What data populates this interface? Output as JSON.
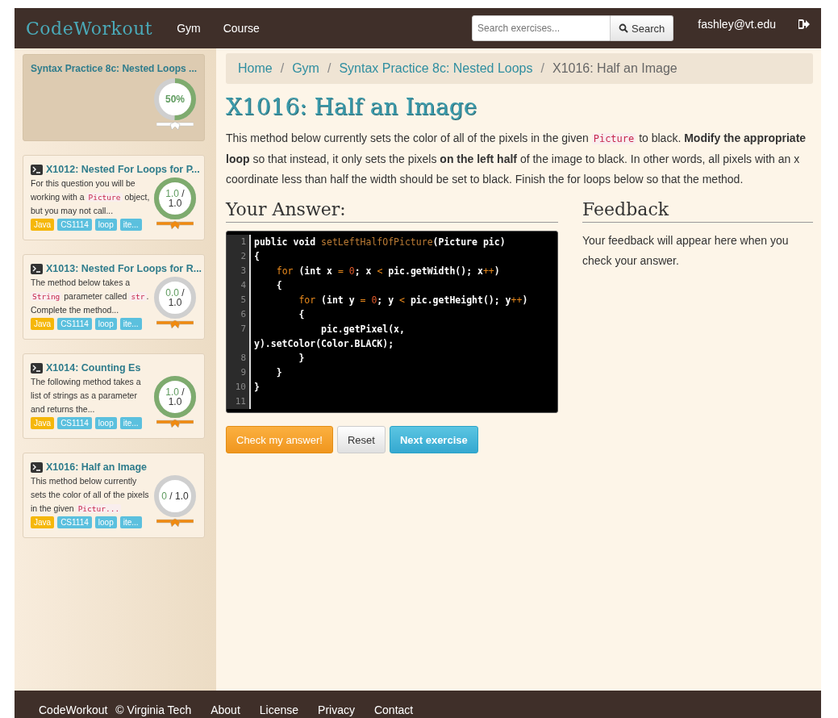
{
  "navbar": {
    "brand": "CodeWorkout",
    "links": [
      "Gym",
      "Course"
    ],
    "search": {
      "placeholder": "Search exercises..."
    },
    "search_button": "Search",
    "user": "fashley@vt.edu"
  },
  "sidebar": {
    "workout": {
      "title": "Syntax Practice 8c: Nested Loops ...",
      "score": "50%",
      "level": 0.5,
      "color": "#ffffff"
    },
    "exercises": [
      {
        "title": "X1012: Nested For Loops for P...",
        "description": [
          {
            "kind": "text",
            "text": "For this question you will be working with a "
          },
          {
            "kind": "code",
            "text": "Picture"
          },
          {
            "kind": "text",
            "text": " object, but you may not call..."
          }
        ],
        "tags": [
          {
            "label": "Java",
            "color": "#f5b70a"
          },
          {
            "label": "CS1114",
            "color": "#5bc0de"
          },
          {
            "label": "loop",
            "color": "#5bc0de"
          },
          {
            "label": "ite...",
            "color": "#5bc0de"
          }
        ],
        "earned": "1.0",
        "sep": "/",
        "possible": "1.0",
        "level": 1,
        "color": "#f08a10"
      },
      {
        "title": "X1013: Nested For Loops for R...",
        "description": [
          {
            "kind": "text",
            "text": "The method below takes a "
          },
          {
            "kind": "code",
            "text": "String"
          },
          {
            "kind": "text",
            "text": " parameter called "
          },
          {
            "kind": "code",
            "text": "str"
          },
          {
            "kind": "text",
            "text": ". Complete the method..."
          }
        ],
        "tags": [
          {
            "label": "Java",
            "color": "#f5b70a"
          },
          {
            "label": "CS1114",
            "color": "#5bc0de"
          },
          {
            "label": "loop",
            "color": "#5bc0de"
          },
          {
            "label": "ite...",
            "color": "#5bc0de"
          }
        ],
        "earned": "0.0",
        "sep": "/",
        "possible": "1.0",
        "level": 0,
        "color": "#f08a10"
      },
      {
        "title": "X1014: Counting Es",
        "description": [
          {
            "kind": "text",
            "text": "The following method takes a list of strings as a parameter and returns the..."
          }
        ],
        "tags": [
          {
            "label": "Java",
            "color": "#f5b70a"
          },
          {
            "label": "CS1114",
            "color": "#5bc0de"
          },
          {
            "label": "loop",
            "color": "#5bc0de"
          },
          {
            "label": "ite...",
            "color": "#5bc0de"
          }
        ],
        "earned": "1.0",
        "sep": "/",
        "possible": "1.0",
        "level": 1,
        "color": "#f08a10"
      },
      {
        "title": "X1016: Half an Image",
        "description": [
          {
            "kind": "text",
            "text": "This method below currently sets the color of all of the pixels in the given "
          },
          {
            "kind": "code",
            "text": "Pictur..."
          }
        ],
        "tags": [
          {
            "label": "Java",
            "color": "#f5b70a"
          },
          {
            "label": "CS1114",
            "color": "#5bc0de"
          },
          {
            "label": "loop",
            "color": "#5bc0de"
          },
          {
            "label": "ite...",
            "color": "#5bc0de"
          }
        ],
        "earned": "0",
        "sep": "/",
        "possible": "1.0",
        "level": 0,
        "color": "#f08a10"
      }
    ]
  },
  "breadcrumb": [
    {
      "label": "Home",
      "link": true
    },
    {
      "separator": "/",
      "label": "Gym",
      "link": true
    },
    {
      "separator": "/",
      "label": "Syntax Practice 8c: Nested Loops",
      "link": true
    },
    {
      "separator": "/",
      "label": "X1016: Half an Image",
      "link": false
    }
  ],
  "title": "X1016: Half an Image",
  "prompt": [
    {
      "kind": "text",
      "text": "This method below currently sets the color of all of the pixels in the given "
    },
    {
      "kind": "code",
      "text": "Picture"
    },
    {
      "kind": "text",
      "text": " to black. "
    },
    {
      "kind": "bold",
      "text": "Modify the appropriate loop"
    },
    {
      "kind": "text",
      "text": " so that instead, it only sets the pixels "
    },
    {
      "kind": "bold",
      "text": "on the left half"
    },
    {
      "kind": "text",
      "text": " of the image to black. In other words, all pixels with an x coordinate less than half the width should be set to black. Finish the for loops below so that the method."
    }
  ],
  "answer": {
    "heading": "Your Answer:",
    "lines": [
      {
        "number": "1",
        "tokens": [
          {
            "kind": "plain",
            "text": "public void "
          },
          {
            "kind": "name",
            "text": "setLeftHalfOfPicture"
          },
          {
            "kind": "plain",
            "text": "(Picture pic)"
          }
        ]
      },
      {
        "number": "2",
        "tokens": [
          {
            "kind": "plain",
            "text": "{"
          }
        ]
      },
      {
        "number": "3",
        "tokens": [
          {
            "kind": "keyword",
            "text": "    for"
          },
          {
            "kind": "plain",
            "text": " (int x "
          },
          {
            "kind": "op",
            "text": "="
          },
          {
            "kind": "number",
            "text": " 0"
          },
          {
            "kind": "plain",
            "text": "; x "
          },
          {
            "kind": "op",
            "text": "<"
          },
          {
            "kind": "plain",
            "text": " pic.getWidth(); x"
          },
          {
            "kind": "op",
            "text": "++"
          },
          {
            "kind": "plain",
            "text": ")"
          }
        ]
      },
      {
        "number": "4",
        "tokens": [
          {
            "kind": "plain",
            "text": "    {"
          }
        ]
      },
      {
        "number": "5",
        "tokens": [
          {
            "kind": "keyword",
            "text": "        for"
          },
          {
            "kind": "plain",
            "text": " (int y "
          },
          {
            "kind": "op",
            "text": "="
          },
          {
            "kind": "number",
            "text": " 0"
          },
          {
            "kind": "plain",
            "text": "; y "
          },
          {
            "kind": "op",
            "text": "<"
          },
          {
            "kind": "plain",
            "text": " pic.getHeight(); y"
          },
          {
            "kind": "op",
            "text": "++"
          },
          {
            "kind": "plain",
            "text": ")"
          }
        ]
      },
      {
        "number": "6",
        "tokens": [
          {
            "kind": "plain",
            "text": "        {"
          }
        ]
      },
      {
        "number": "7",
        "tokens": [
          {
            "kind": "plain",
            "text": "            pic.getPixel(x, y).setColor(Color.BLACK);"
          }
        ]
      },
      {
        "number": "8",
        "tokens": [
          {
            "kind": "plain",
            "text": "        }"
          }
        ]
      },
      {
        "number": "9",
        "tokens": [
          {
            "kind": "plain",
            "text": "    }"
          }
        ]
      },
      {
        "number": "10",
        "tokens": [
          {
            "kind": "plain",
            "text": "}"
          }
        ]
      },
      {
        "number": "11"
      }
    ]
  },
  "feedback": {
    "heading": "Feedback",
    "text": "Your feedback will appear here when you check your answer."
  },
  "buttons": [
    {
      "label": "Check my answer!",
      "kind": "warning"
    },
    {
      "label": "Reset",
      "kind": "default"
    },
    {
      "label": "Next exercise",
      "kind": "info"
    }
  ],
  "footer": {
    "brand": "CodeWorkout",
    "copyright": "© Virginia Tech",
    "links": [
      "About",
      "License",
      "Privacy",
      "Contact"
    ]
  }
}
